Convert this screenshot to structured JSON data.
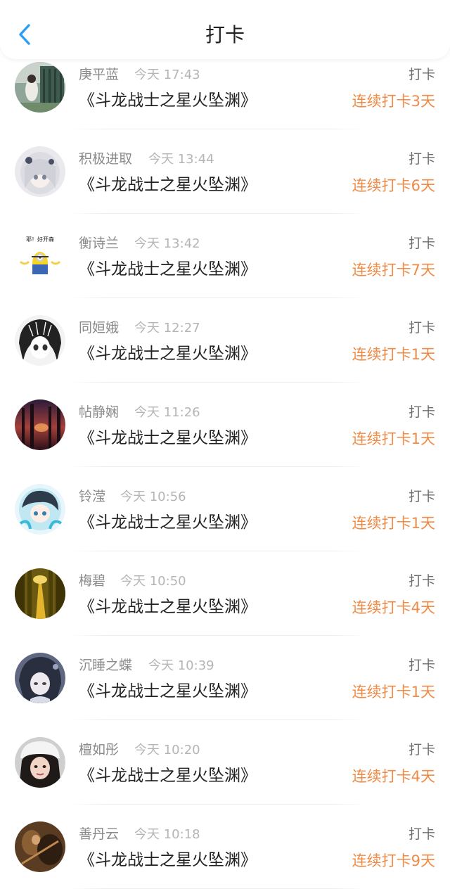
{
  "header": {
    "title": "打卡",
    "back_icon": "chevron-left-icon",
    "accent_color": "#2a9df4"
  },
  "colors": {
    "streak": "#f08a45",
    "muted": "#8a8a8a",
    "time": "#b5b5b5"
  },
  "checkins": [
    {
      "user": "庚平蓝",
      "time": "今天 17:43",
      "book": "《斗龙战士之星火坠渊》",
      "action": "打卡",
      "streak": "连续打卡3天",
      "avatar": "avatar-park-photo"
    },
    {
      "user": "积极进取",
      "time": "今天 13:44",
      "book": "《斗龙战士之星火坠渊》",
      "action": "打卡",
      "streak": "连续打卡6天",
      "avatar": "avatar-anime-girl"
    },
    {
      "user": "衡诗兰",
      "time": "今天 13:42",
      "book": "《斗龙战士之星火坠渊》",
      "action": "打卡",
      "streak": "连续打卡7天",
      "avatar": "avatar-minion",
      "avatar_text": "耶！好开森"
    },
    {
      "user": "同姮娥",
      "time": "今天 12:27",
      "book": "《斗龙战士之星火坠渊》",
      "action": "打卡",
      "streak": "连续打卡1天",
      "avatar": "avatar-manga-sketch"
    },
    {
      "user": "帖静娴",
      "time": "今天 11:26",
      "book": "《斗龙战士之星火坠渊》",
      "action": "打卡",
      "streak": "连续打卡1天",
      "avatar": "avatar-sunset-forest"
    },
    {
      "user": "铃滢",
      "time": "今天 10:56",
      "book": "《斗龙战士之星火坠渊》",
      "action": "打卡",
      "streak": "连续打卡1天",
      "avatar": "avatar-chibi-blue"
    },
    {
      "user": "梅碧",
      "time": "今天 10:50",
      "book": "《斗龙战士之星火坠渊》",
      "action": "打卡",
      "streak": "连续打卡4天",
      "avatar": "avatar-autumn-path"
    },
    {
      "user": "沉睡之蝶",
      "time": "今天 10:39",
      "book": "《斗龙战士之星火坠渊》",
      "action": "打卡",
      "streak": "连续打卡1天",
      "avatar": "avatar-dark-anime"
    },
    {
      "user": "檀如彤",
      "time": "今天 10:20",
      "book": "《斗龙战士之星火坠渊》",
      "action": "打卡",
      "streak": "连续打卡4天",
      "avatar": "avatar-girl-cap"
    },
    {
      "user": "善丹云",
      "time": "今天 10:18",
      "book": "《斗龙战士之星火坠渊》",
      "action": "打卡",
      "streak": "连续打卡9天",
      "avatar": "avatar-brown-photo"
    }
  ]
}
